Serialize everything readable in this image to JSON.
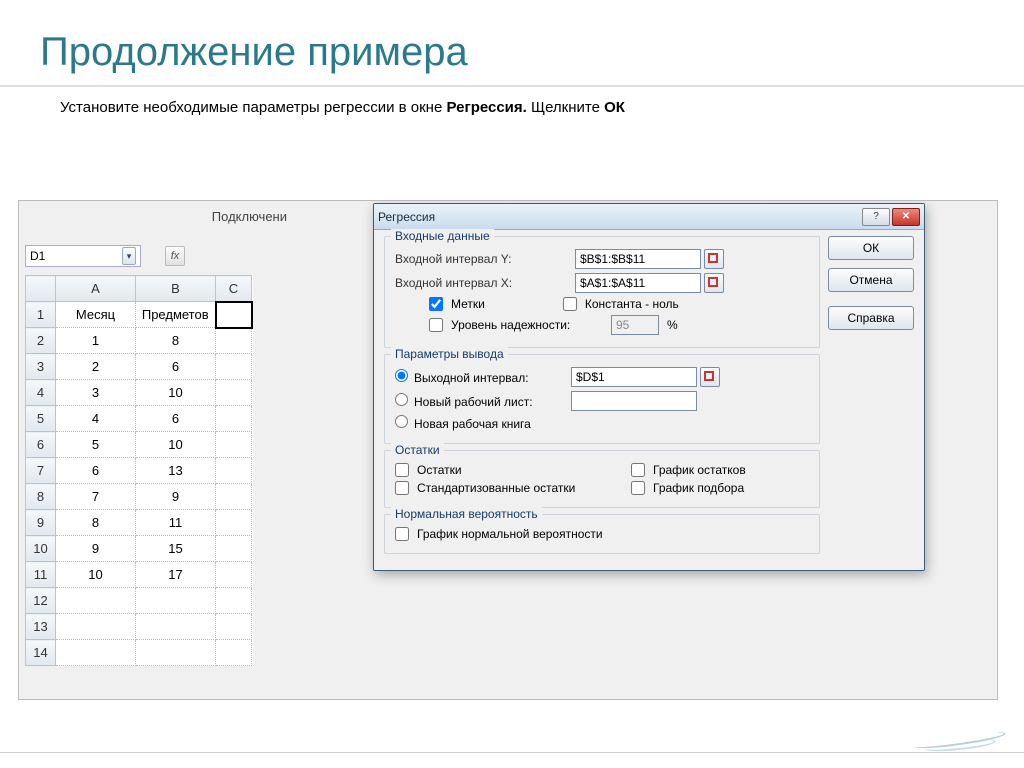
{
  "slide": {
    "title": "Продолжение примера",
    "instruction_prefix": "Установите необходимые параметры регрессии в окне ",
    "instruction_bold1": "Регрессия. ",
    "instruction_mid": "Щелкните ",
    "instruction_bold2": "ОК"
  },
  "excel": {
    "connections_label": "Подключени",
    "name_box": "D1",
    "fx_label": "fx",
    "columns": [
      "A",
      "B",
      "C"
    ],
    "rows": [
      {
        "n": "1",
        "a": "Месяц",
        "b": "Предметов",
        "d1": true
      },
      {
        "n": "2",
        "a": "1",
        "b": "8"
      },
      {
        "n": "3",
        "a": "2",
        "b": "6"
      },
      {
        "n": "4",
        "a": "3",
        "b": "10"
      },
      {
        "n": "5",
        "a": "4",
        "b": "6"
      },
      {
        "n": "6",
        "a": "5",
        "b": "10"
      },
      {
        "n": "7",
        "a": "6",
        "b": "13"
      },
      {
        "n": "8",
        "a": "7",
        "b": "9"
      },
      {
        "n": "9",
        "a": "8",
        "b": "11"
      },
      {
        "n": "10",
        "a": "9",
        "b": "15"
      },
      {
        "n": "11",
        "a": "10",
        "b": "17"
      },
      {
        "n": "12",
        "a": "",
        "b": ""
      },
      {
        "n": "13",
        "a": "",
        "b": ""
      },
      {
        "n": "14",
        "a": "",
        "b": ""
      }
    ]
  },
  "dialog": {
    "title": "Регрессия",
    "ok": "ОК",
    "cancel": "Отмена",
    "help": "Справка",
    "group_input": "Входные данные",
    "label_y": "Входной интервал Y:",
    "value_y": "$B$1:$B$11",
    "label_x": "Входной интервал X:",
    "value_x": "$A$1:$A$11",
    "labels_check": "Метки",
    "const_zero": "Константа - ноль",
    "conf_level": "Уровень надежности:",
    "conf_value": "95",
    "pct": "%",
    "group_output": "Параметры вывода",
    "out_range": "Выходной интервал:",
    "out_value": "$D$1",
    "new_sheet": "Новый рабочий лист:",
    "new_book": "Новая рабочая книга",
    "group_resid": "Остатки",
    "resid": "Остатки",
    "resid_plot": "График остатков",
    "std_resid": "Стандартизованные остатки",
    "fit_plot": "График подбора",
    "group_prob": "Нормальная вероятность",
    "prob_plot": "График нормальной вероятности"
  }
}
